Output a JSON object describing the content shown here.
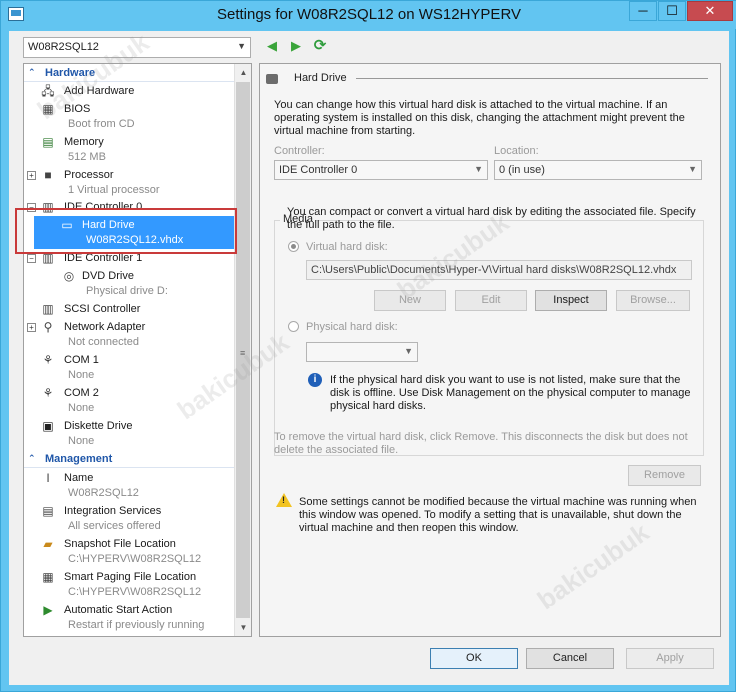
{
  "window": {
    "title": "Settings for W08R2SQL12 on WS12HYPERV",
    "controls": {
      "minimize": "─",
      "maximize": "☐",
      "close": "✕"
    }
  },
  "vm_selector": {
    "value": "W08R2SQL12"
  },
  "toolbar": {
    "back": "◀",
    "forward": "▶",
    "refresh": "⟳"
  },
  "tree": {
    "hardware_header": "Hardware",
    "management_header": "Management",
    "items": [
      {
        "name": "Add Hardware",
        "sub": ""
      },
      {
        "name": "BIOS",
        "sub": "Boot from CD"
      },
      {
        "name": "Memory",
        "sub": "512 MB"
      },
      {
        "name": "Processor",
        "sub": "1 Virtual processor"
      },
      {
        "name": "IDE Controller 0",
        "sub": ""
      },
      {
        "name": "Hard Drive",
        "sub": "W08R2SQL12.vhdx"
      },
      {
        "name": "IDE Controller 1",
        "sub": ""
      },
      {
        "name": "DVD Drive",
        "sub": "Physical drive D:"
      },
      {
        "name": "SCSI Controller",
        "sub": ""
      },
      {
        "name": "Network Adapter",
        "sub": "Not connected"
      },
      {
        "name": "COM 1",
        "sub": "None"
      },
      {
        "name": "COM 2",
        "sub": "None"
      },
      {
        "name": "Diskette Drive",
        "sub": "None"
      }
    ],
    "management_items": [
      {
        "name": "Name",
        "sub": "W08R2SQL12"
      },
      {
        "name": "Integration Services",
        "sub": "All services offered"
      },
      {
        "name": "Snapshot File Location",
        "sub": "C:\\HYPERV\\W08R2SQL12"
      },
      {
        "name": "Smart Paging File Location",
        "sub": "C:\\HYPERV\\W08R2SQL12"
      },
      {
        "name": "Automatic Start Action",
        "sub": "Restart if previously running"
      }
    ],
    "selected": "Hard Drive"
  },
  "details": {
    "group_title": "Hard Drive",
    "intro": "You can change how this virtual hard disk is attached to the virtual machine. If an operating system is installed on this disk, changing the attachment might prevent the virtual machine from starting.",
    "controller_label": "Controller:",
    "controller_value": "IDE Controller 0",
    "location_label": "Location:",
    "location_value": "0 (in use)",
    "media_label": "Media",
    "media_text": "You can compact or convert a virtual hard disk by editing the associated file. Specify the full path to the file.",
    "virtual_disk_label": "Virtual hard disk:",
    "virtual_disk_path": "C:\\Users\\Public\\Documents\\Hyper-V\\Virtual hard disks\\W08R2SQL12.vhdx",
    "buttons": {
      "new": "New",
      "edit": "Edit",
      "inspect": "Inspect",
      "browse": "Browse..."
    },
    "physical_disk_label": "Physical hard disk:",
    "physical_disk_value": "",
    "physical_info": "If the physical hard disk you want to use is not listed, make sure that the disk is offline. Use Disk Management on the physical computer to manage physical hard disks.",
    "remove_text": "To remove the virtual hard disk, click Remove. This disconnects the disk but does not delete the associated file.",
    "remove_button": "Remove",
    "warning": "Some settings cannot be modified because the virtual machine was running when this window was opened. To modify a setting that is unavailable, shut down the virtual machine and then reopen this window."
  },
  "footer": {
    "ok": "OK",
    "cancel": "Cancel",
    "apply": "Apply"
  },
  "watermark": "bakicubuk"
}
